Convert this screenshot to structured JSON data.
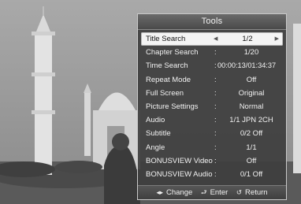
{
  "menu": {
    "title": "Tools",
    "items": [
      {
        "label": "Title Search",
        "value": "1/2"
      },
      {
        "label": "Chapter Search",
        "value": "1/20"
      },
      {
        "label": "Time Search",
        "value": "00:00:13/01:34:37"
      },
      {
        "label": "Repeat Mode",
        "value": "Off"
      },
      {
        "label": "Full Screen",
        "value": "Original"
      },
      {
        "label": "Picture Settings",
        "value": "Normal"
      },
      {
        "label": "Audio",
        "value": "1/1 JPN 2CH"
      },
      {
        "label": "Subtitle",
        "value": "0/2 Off"
      },
      {
        "label": "Angle",
        "value": "1/1"
      },
      {
        "label": "BONUSVIEW Video",
        "value": "Off"
      },
      {
        "label": "BONUSVIEW Audio",
        "value": "0/1 Off"
      }
    ],
    "selected_index": 0
  },
  "footer": {
    "change_label": "Change",
    "enter_label": "Enter",
    "return_label": "Return",
    "change_icon": "left-right-arrows-icon",
    "enter_icon": "enter-icon",
    "return_icon": "return-arrow-icon"
  },
  "colors": {
    "panel_bg": "#3e3e3e",
    "highlight": "#f4f4f4",
    "text": "#f2f2f2"
  }
}
